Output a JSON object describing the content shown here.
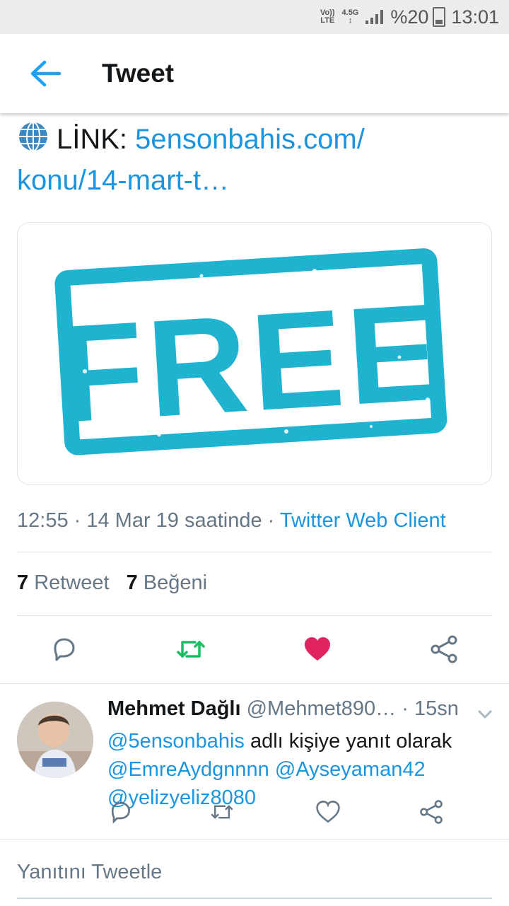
{
  "status_bar": {
    "volte_top": "Vo))",
    "volte_bottom": "LTE",
    "network_top": "4.5G",
    "network_bottom": "↕",
    "battery": "%20",
    "time": "13:01"
  },
  "header": {
    "back_icon": "arrow-left-icon",
    "title": "Tweet"
  },
  "tweet": {
    "link_prefix": "LİNK: ",
    "link_line1": "5ensonbahis.com/",
    "link_line2": "konu/14-mart-t…",
    "image_text": "FREE",
    "image_color": "#1fb3d0",
    "time_date": "12:55 · 14 Mar 19 saatinde · ",
    "client": "Twitter Web Client",
    "retweet_count": "7",
    "retweet_label": "Retweet",
    "like_count": "7",
    "like_label": "Beğeni"
  },
  "actions": {
    "reply_icon": "reply-icon",
    "retweet_icon": "retweet-icon",
    "like_icon": "heart-icon",
    "share_icon": "share-icon",
    "retweet_color": "#17bf63",
    "like_color": "#e0245e"
  },
  "reply": {
    "name": "Mehmet Dağlı",
    "handle": "@Mehmet890…",
    "time": "· 15sn",
    "mention_to": "@5ensonbahis",
    "reply_text": " adlı kişiye yanıt olarak",
    "mention_1": "@EmreAydgnnnn",
    "mention_2": "@Ayseyaman42",
    "mention_3": "@yelizyeliz8080"
  },
  "compose": {
    "placeholder": "Yanıtını Tweetle"
  }
}
